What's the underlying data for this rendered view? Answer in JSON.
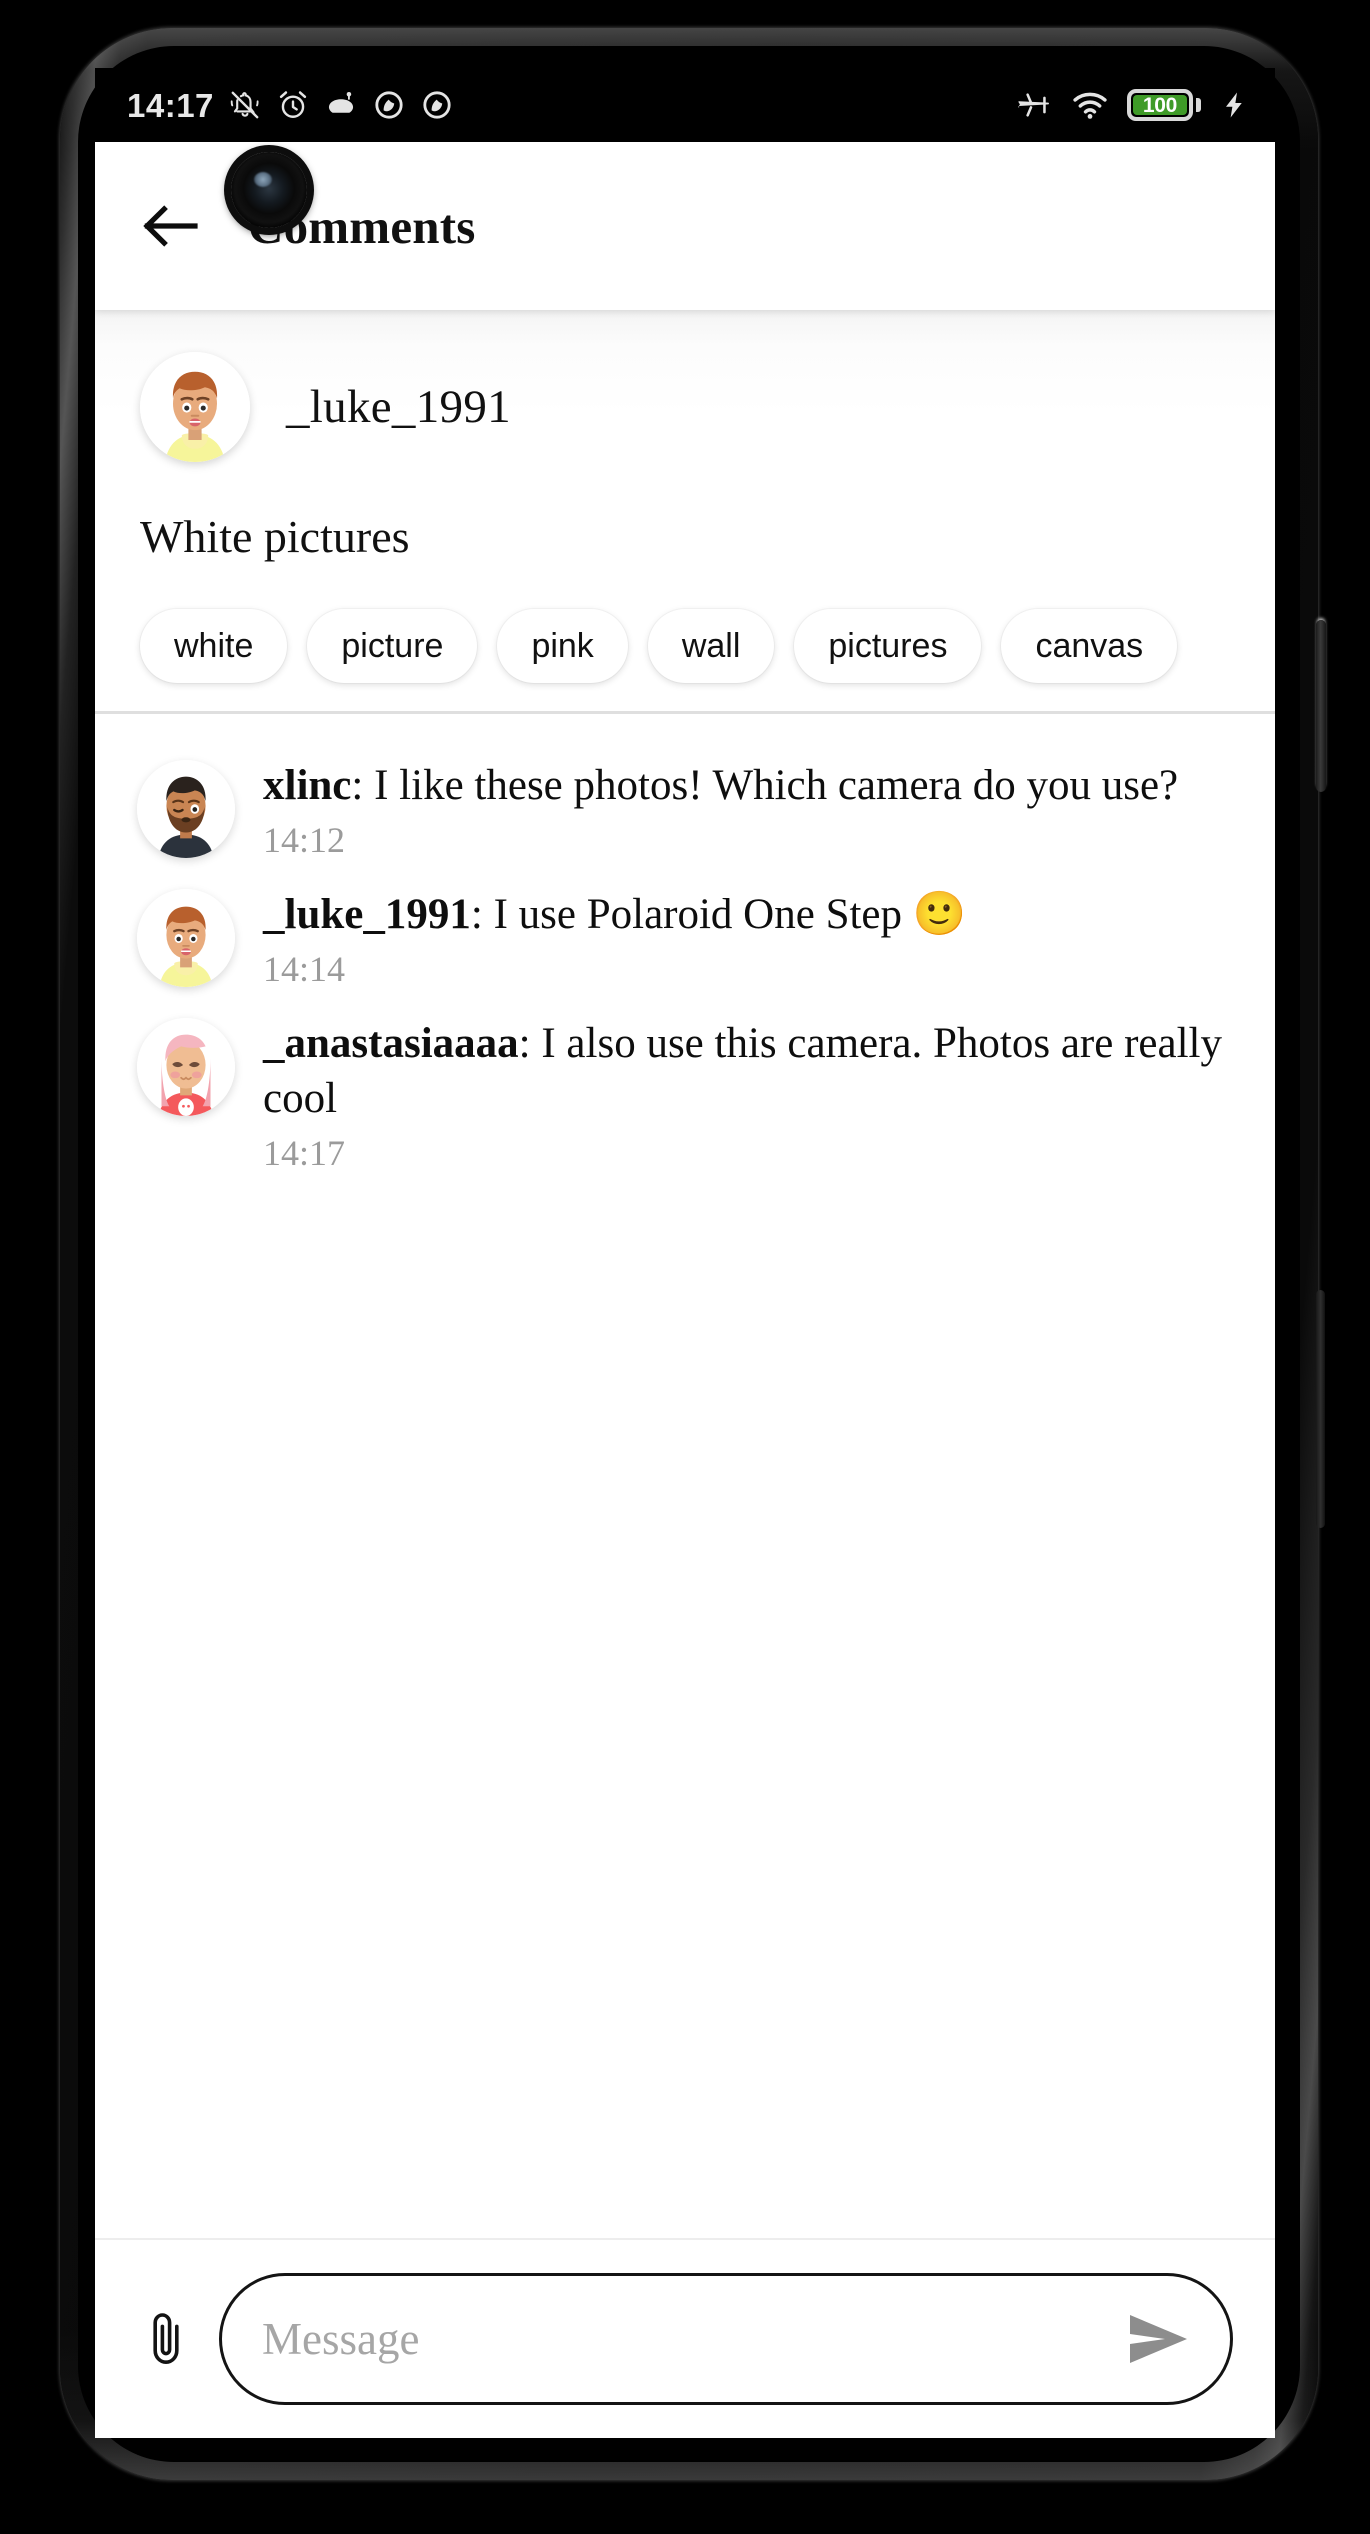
{
  "status_bar": {
    "time": "14:17",
    "notification_icons": [
      "bell-off-icon",
      "alarm-icon",
      "app-icon",
      "block-icon",
      "block-icon"
    ],
    "airplane_mode_icon": "airplane-icon",
    "wifi_icon": "wifi-icon",
    "battery_percent": "100",
    "battery_color": "#3f9b28",
    "charging_icon": "bolt-icon"
  },
  "appbar": {
    "back_icon": "back-arrow-icon",
    "title": "Comments"
  },
  "post": {
    "author": "_luke_1991",
    "avatar": "avatar-luke",
    "title": "White pictures",
    "tags": [
      "white",
      "picture",
      "pink",
      "wall",
      "pictures",
      "canvas"
    ]
  },
  "comments": [
    {
      "avatar": "avatar-xlinc",
      "user": "xlinc",
      "separator": ": ",
      "text": "I like these photos! Which camera do you use?",
      "time": "14:12"
    },
    {
      "avatar": "avatar-luke",
      "user": "_luke_1991",
      "separator": ": ",
      "text": "I use Polaroid One Step 🙂",
      "time": "14:14"
    },
    {
      "avatar": "avatar-anastasia",
      "user": "_anastasiaaaa",
      "separator": ": ",
      "text": "I also use this camera. Photos are really cool",
      "time": "14:17"
    }
  ],
  "composer": {
    "attach_icon": "paperclip-icon",
    "input_value": "",
    "placeholder": "Message",
    "send_icon": "send-icon"
  },
  "nav": {
    "home_indicator": "home-indicator"
  }
}
